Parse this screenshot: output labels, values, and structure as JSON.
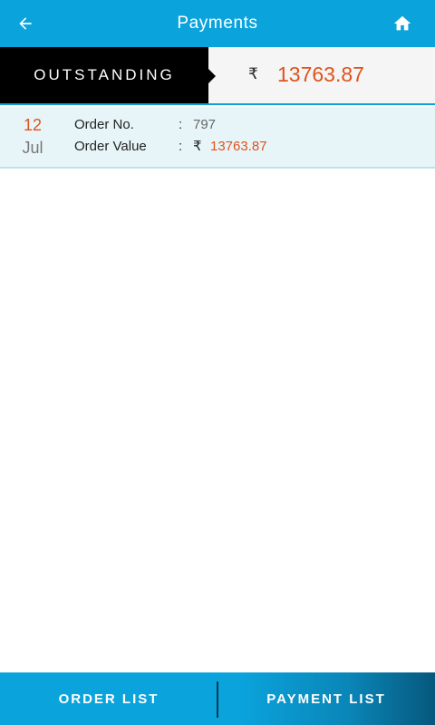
{
  "header": {
    "title": "Payments",
    "back_icon": "arrow-left-icon",
    "home_icon": "home-icon"
  },
  "outstanding": {
    "label": "OUTSTANDING",
    "currency_symbol": "₹",
    "amount": "13763.87"
  },
  "orders": [
    {
      "day": "12",
      "month": "Jul",
      "order_no_label": "Order No.",
      "order_no": "797",
      "order_value_label": "Order Value",
      "currency_symbol": "₹",
      "order_value": "13763.87",
      "separator": ":"
    }
  ],
  "bottom_nav": {
    "order_list_label": "ORDER LIST",
    "payment_list_label": "PAYMENT LIST"
  },
  "colors": {
    "primary": "#0aa3dc",
    "accent": "#e0521c",
    "label_bg": "#000000",
    "row_bg": "#e8f5f8"
  }
}
